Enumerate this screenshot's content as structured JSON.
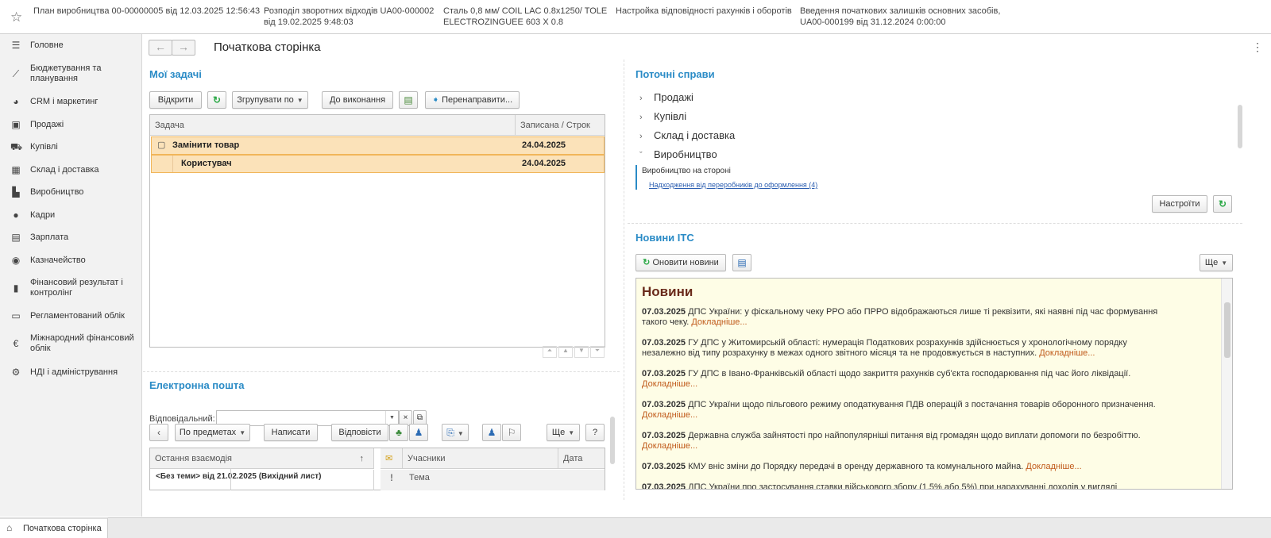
{
  "history": [
    "План виробництва 00-00000005 від 12.03.2025 12:56:43",
    "Розподіл зворотних відходів UA00-000002",
    "від 19.02.2025 9:48:03",
    "Сталь 0,8 мм/ COIL LAC 0.8x1250/ TOLE",
    "ELECTROZINGUEE 603 X 0.8",
    "Настройка відповідності рахунків і оборотів",
    "Введення початкових залишків основних засобів,",
    "UA00-000199 від 31.12.2024 0:00:00"
  ],
  "sidebar": {
    "items": [
      {
        "label": "Головне"
      },
      {
        "label": "Бюджетування та планування"
      },
      {
        "label": "CRM і маркетинг"
      },
      {
        "label": "Продажі"
      },
      {
        "label": "Купівлі"
      },
      {
        "label": "Склад і доставка"
      },
      {
        "label": "Виробництво"
      },
      {
        "label": "Кадри"
      },
      {
        "label": "Зарплата"
      },
      {
        "label": "Казначейство"
      },
      {
        "label": "Фінансовий результат і контролінг"
      },
      {
        "label": "Регламентований облік"
      },
      {
        "label": "Міжнародний фінансовий облік"
      },
      {
        "label": "НДІ і адміністрування"
      }
    ]
  },
  "page": {
    "title": "Початкова сторінка"
  },
  "tasks": {
    "title": "Мої задачі",
    "open_btn": "Відкрити",
    "group_btn": "Згрупувати по",
    "todo_btn": "До виконання",
    "redirect_btn": "Перенаправити...",
    "col_task": "Задача",
    "col_date": "Записана / Строк",
    "rows": [
      {
        "task": "Замінити товар",
        "date": "24.04.2025"
      },
      {
        "task": "Користувач",
        "date": "24.04.2025"
      }
    ]
  },
  "current": {
    "title": "Поточні справи",
    "items": [
      "Продажі",
      "Купівлі",
      "Склад і доставка",
      "Виробництво"
    ],
    "sub_title": "Виробництво на стороні",
    "sub_link": "Надходження від переробників до оформлення (4)",
    "settings_btn": "Настроїти"
  },
  "news": {
    "title": "Новини ІТС",
    "refresh_btn": "Оновити новини",
    "more_btn": "Ще",
    "header": "Новини",
    "more_link": "Докладніше...",
    "items": [
      {
        "date": "07.03.2025",
        "text": "ДПС України: у фіскальному чеку РРО або ПРРО відображаються лише ті реквізити, які наявні під час формування",
        "text2": "такого чеку."
      },
      {
        "date": "07.03.2025",
        "text": "ГУ ДПС у Житомирській області: нумерація Податкових розрахунків здійснюється у хронологічному порядку",
        "text2": "незалежно від типу розрахунку в межах одного звітного місяця та не продовжується в наступних."
      },
      {
        "date": "07.03.2025",
        "text": "ГУ ДПС в Івано-Франківській області щодо закриття рахунків суб'єкта господарювання під час його ліквідації.",
        "text2": ""
      },
      {
        "date": "07.03.2025",
        "text": "ДПС України щодо пільгового режиму оподаткування ПДВ операцій з постачання товарів оборонного призначення.",
        "text2": ""
      },
      {
        "date": "07.03.2025",
        "text": "Державна служба зайнятості про найпопулярніші питання від громадян щодо виплати допомоги по безробіттю.",
        "text2": ""
      },
      {
        "date": "07.03.2025",
        "text": "КМУ вніс зміни до Порядку передачі в оренду державного та комунального майна.",
        "text2": ""
      },
      {
        "date": "07.03.2025",
        "text": "ДПС України про застосування ставки військового збору (1,5% або 5%) при нарахуванні доходів у вигляді",
        "text2": ""
      }
    ]
  },
  "mail": {
    "title": "Електронна пошта",
    "responsible_label": "Відповідальний:",
    "by_subject_btn": "По предметах",
    "write_btn": "Написати",
    "reply_btn": "Відповісти",
    "more_btn": "Ще",
    "help_btn": "?",
    "col_last": "Остання взаємодія",
    "col_participants": "Учасники",
    "col_date": "Дата",
    "col_topic": "Тема",
    "row_last": "<Без теми> від 21.02.2025 (Вихідний лист)"
  },
  "bottom": {
    "tab": "Початкова сторінка"
  }
}
